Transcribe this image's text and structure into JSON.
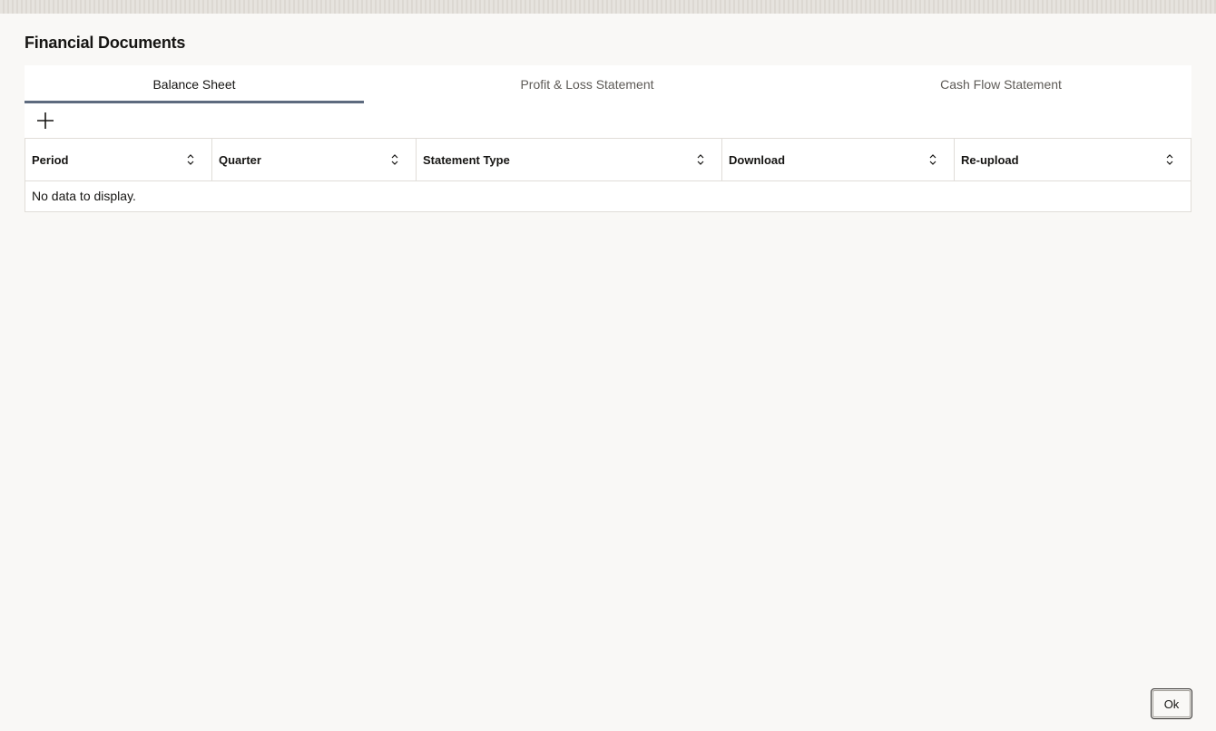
{
  "page": {
    "title": "Financial Documents"
  },
  "tabs": [
    {
      "label": "Balance Sheet",
      "active": true
    },
    {
      "label": "Profit & Loss Statement",
      "active": false
    },
    {
      "label": "Cash Flow Statement",
      "active": false
    }
  ],
  "toolbar": {
    "add_icon": "plus-icon"
  },
  "table": {
    "columns": [
      {
        "label": "Period"
      },
      {
        "label": "Quarter"
      },
      {
        "label": "Statement Type"
      },
      {
        "label": "Download"
      },
      {
        "label": "Re-upload"
      }
    ],
    "sort_icon": "sort-updown-icon",
    "empty_message": "No data to display."
  },
  "footer": {
    "ok_label": "Ok"
  },
  "colors": {
    "active_tab_indicator": "#5d6a7e",
    "background": "#f9f8f6"
  }
}
